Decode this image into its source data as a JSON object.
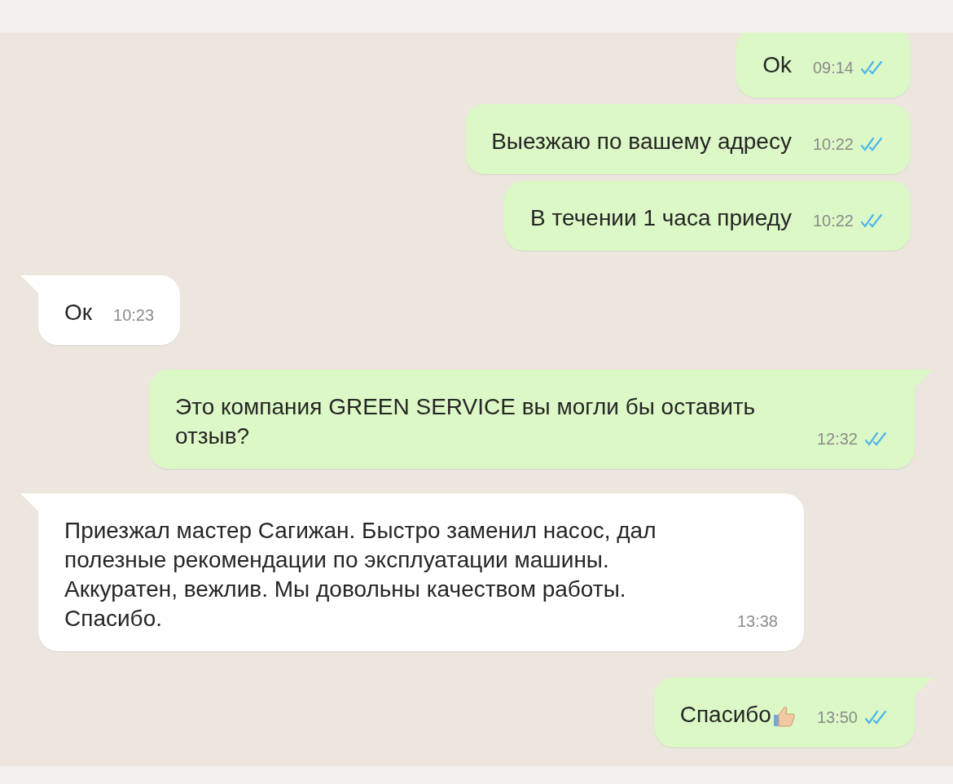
{
  "messages": [
    {
      "kind": "outgoing",
      "text": "Ok",
      "time": "09:14",
      "read": true,
      "tail": false,
      "emoji": false
    },
    {
      "kind": "outgoing",
      "text": "Выезжаю по вашему адресу",
      "time": "10:22",
      "read": true,
      "tail": false,
      "emoji": false
    },
    {
      "kind": "outgoing",
      "text": "В течении 1 часа приеду",
      "time": "10:22",
      "read": true,
      "tail": false,
      "emoji": false
    },
    {
      "kind": "incoming",
      "text": "Ок",
      "time": "10:23",
      "tail": true,
      "emoji": false
    },
    {
      "kind": "outgoing",
      "text": "Это компания GREEN SERVICE вы могли бы оставить отзыв?",
      "time": "12:32",
      "read": true,
      "tail": true,
      "emoji": false
    },
    {
      "kind": "incoming",
      "text": "Приезжал мастер Сагижан. Быстро заменил насос, дал полезные рекомендации по эксплуатации машины. Аккуратен, вежлив. Мы довольны качеством работы. Спасибо.",
      "time": "13:38",
      "tail": true,
      "emoji": false
    },
    {
      "kind": "outgoing",
      "text": "Спасибо",
      "time": "13:50",
      "read": true,
      "tail": true,
      "emoji": true
    }
  ]
}
